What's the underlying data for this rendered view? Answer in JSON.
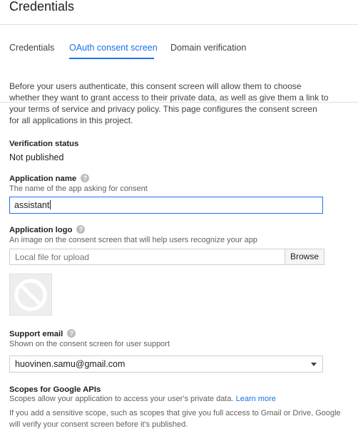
{
  "page": {
    "title": "Credentials"
  },
  "tabs": [
    {
      "label": "Credentials",
      "active": false
    },
    {
      "label": "OAuth consent screen",
      "active": true
    },
    {
      "label": "Domain verification",
      "active": false
    }
  ],
  "intro_text": "Before your users authenticate, this consent screen will allow them to choose whether they want to grant access to their private data, as well as give them a link to your terms of service and privacy policy. This page configures the consent screen for all applications in this project.",
  "verification": {
    "label": "Verification status",
    "value": "Not published"
  },
  "app_name": {
    "label": "Application name",
    "hint": "The name of the app asking for consent",
    "value": "assistant"
  },
  "app_logo": {
    "label": "Application logo",
    "hint": "An image on the consent screen that will help users recognize your app",
    "placeholder": "Local file for upload",
    "browse_label": "Browse"
  },
  "support_email": {
    "label": "Support email",
    "hint": "Shown on the consent screen for user support",
    "selected": "huovinen.samu@gmail.com"
  },
  "scopes": {
    "label": "Scopes for Google APIs",
    "desc": "Scopes allow your application to access your user's private data.",
    "learn_more": "Learn more",
    "note": "If you add a sensitive scope, such as scopes that give you full access to Gmail or Drive, Google will verify your consent screen before it's published."
  },
  "icons": {
    "help": "help-icon",
    "no_image": "no-image-icon",
    "dropdown": "chevron-down-icon"
  },
  "colors": {
    "accent": "#1a73e8",
    "border": "#cfcfcf",
    "text": "#212121",
    "muted": "#616161"
  }
}
